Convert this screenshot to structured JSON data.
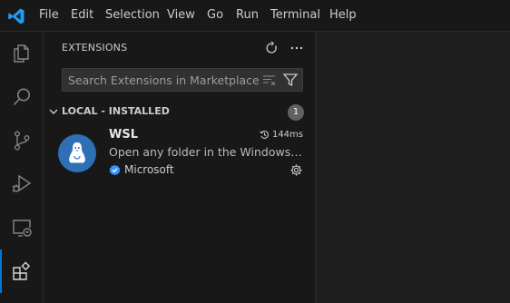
{
  "menu": [
    "File",
    "Edit",
    "Selection",
    "View",
    "Go",
    "Run",
    "Terminal",
    "Help"
  ],
  "activity_bar": [
    "explorer-icon",
    "search-icon",
    "source-control-icon",
    "run-debug-icon",
    "remote-explorer-icon",
    "extensions-icon"
  ],
  "sidebar": {
    "title": "EXTENSIONS",
    "search_placeholder": "Search Extensions in Marketplace",
    "section": {
      "label": "LOCAL - INSTALLED",
      "count": "1"
    },
    "extension": {
      "name": "WSL",
      "activation_time": "144ms",
      "description": "Open any folder in the Windows Subsystem for Linux (WSL) and take advantage of Visual Studio Code's full feature set.",
      "publisher": "Microsoft"
    }
  },
  "colors": {
    "accent": "#0078d4",
    "background": "#1f1f1f",
    "sidebar": "#181818",
    "verified": "#3794ff"
  }
}
